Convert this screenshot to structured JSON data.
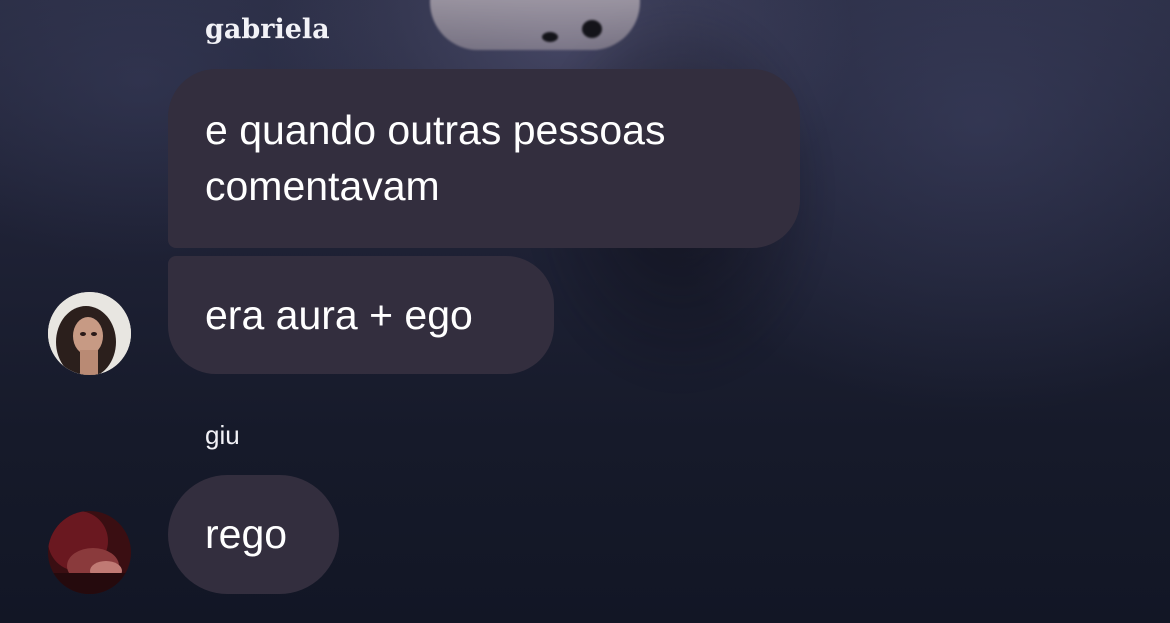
{
  "chat": {
    "groups": [
      {
        "sender": "gabriela",
        "messages": [
          "e quando outras pessoas comentavam",
          "era aura + ego"
        ],
        "avatar": "profile-photo-gabriela"
      },
      {
        "sender": "giu",
        "messages": [
          "rego"
        ],
        "avatar": "profile-photo-giu"
      }
    ]
  },
  "colors": {
    "bubble": "#332e3e",
    "background": "#1c2033",
    "text": "#ffffff"
  }
}
